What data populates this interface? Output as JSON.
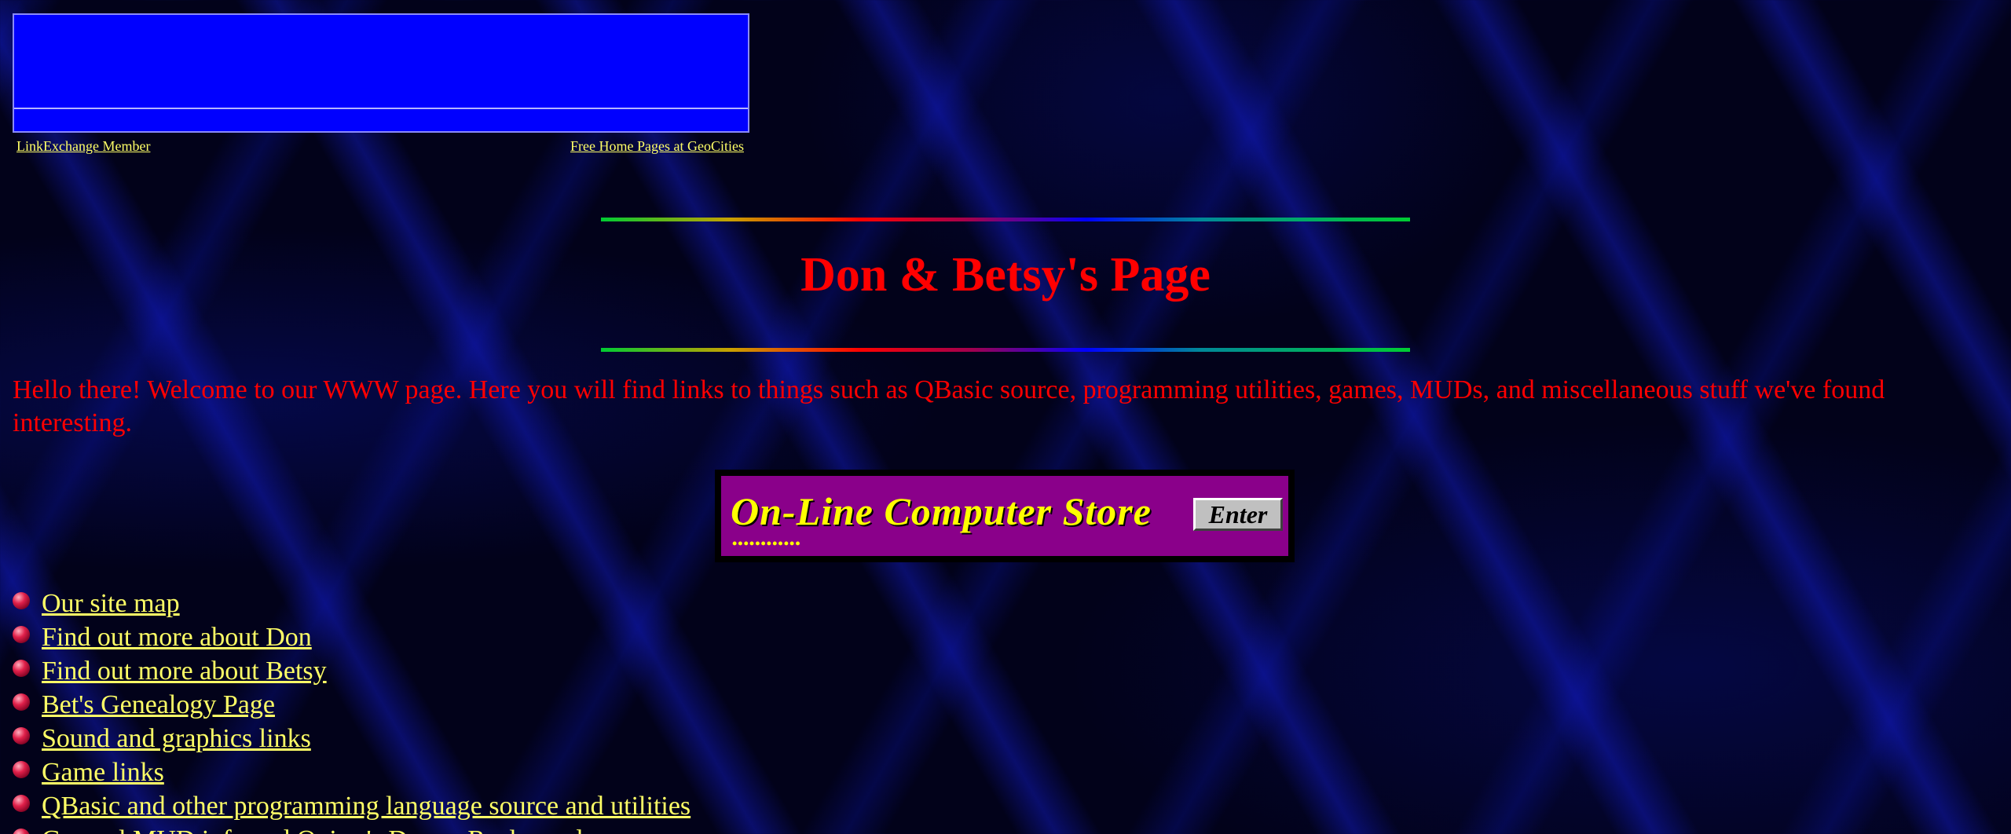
{
  "banner": {
    "left_link": "LinkExchange Member",
    "right_link": "Free Home Pages at GeoCities",
    "color": "#0000ff"
  },
  "title": "Don & Betsy's Page",
  "intro": "Hello there! Welcome to our WWW page. Here you will find links to things such as QBasic source, programming utilities, games, MUDs, and miscellaneous stuff we've found interesting.",
  "store": {
    "title": "On-Line Computer Store",
    "button": "Enter",
    "dots": "••••••••••••",
    "bg_color": "#8a008a"
  },
  "links": [
    {
      "label": "Our site map",
      "icon": "ruby-bullet-icon"
    },
    {
      "label": "Find out more about Don",
      "icon": "ruby-bullet-icon"
    },
    {
      "label": "Find out more about Betsy",
      "icon": "ruby-bullet-icon"
    },
    {
      "label": "Bet's Genealogy Page",
      "icon": "ruby-bullet-icon"
    },
    {
      "label": "Sound and graphics links",
      "icon": "ruby-bullet-icon"
    },
    {
      "label": "Game links",
      "icon": "ruby-bullet-icon"
    },
    {
      "label": "QBasic and other programming language source and utilities",
      "icon": "ruby-bullet-icon"
    },
    {
      "label": "General MUD info and Quirm's Dream Realm and",
      "icon": "ruby-bullet-icon"
    }
  ],
  "colors": {
    "text": "#ff0000",
    "link": "#ffff66",
    "background": "#02021a"
  }
}
